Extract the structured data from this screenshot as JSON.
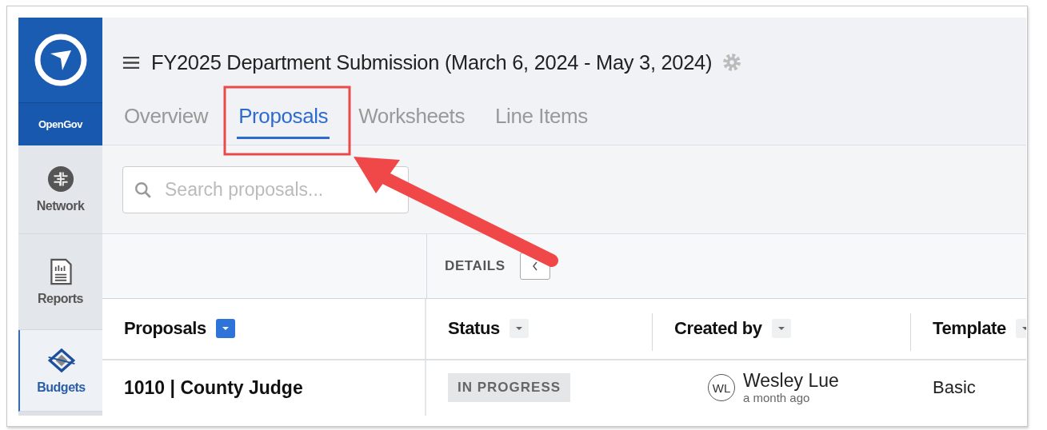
{
  "logo": {
    "text": "OpenGov"
  },
  "sidebar": [
    {
      "label": "Network",
      "kind": "network",
      "selected": false
    },
    {
      "label": "Reports",
      "kind": "reports",
      "selected": false
    },
    {
      "label": "Budgets",
      "kind": "budgets",
      "selected": true
    }
  ],
  "header": {
    "title": "FY2025 Department Submission (March 6, 2024 - May 3, 2024)"
  },
  "tabs": [
    {
      "label": "Overview",
      "selected": false
    },
    {
      "label": "Proposals",
      "selected": true
    },
    {
      "label": "Worksheets",
      "selected": false
    },
    {
      "label": "Line Items",
      "selected": false
    }
  ],
  "search": {
    "placeholder": "Search proposals..."
  },
  "details": {
    "label": "DETAILS"
  },
  "table": {
    "columns": [
      {
        "label": "Proposals",
        "filter_active": true
      },
      {
        "label": "Status",
        "filter_active": false
      },
      {
        "label": "Created by",
        "filter_active": false
      },
      {
        "label": "Template",
        "filter_active": false
      }
    ],
    "rows": [
      {
        "proposal": "1010 | County Judge",
        "status": "IN PROGRESS",
        "creator_initials": "WL",
        "creator": "Wesley Lue",
        "created": "a month ago",
        "template": "Basic"
      }
    ]
  }
}
